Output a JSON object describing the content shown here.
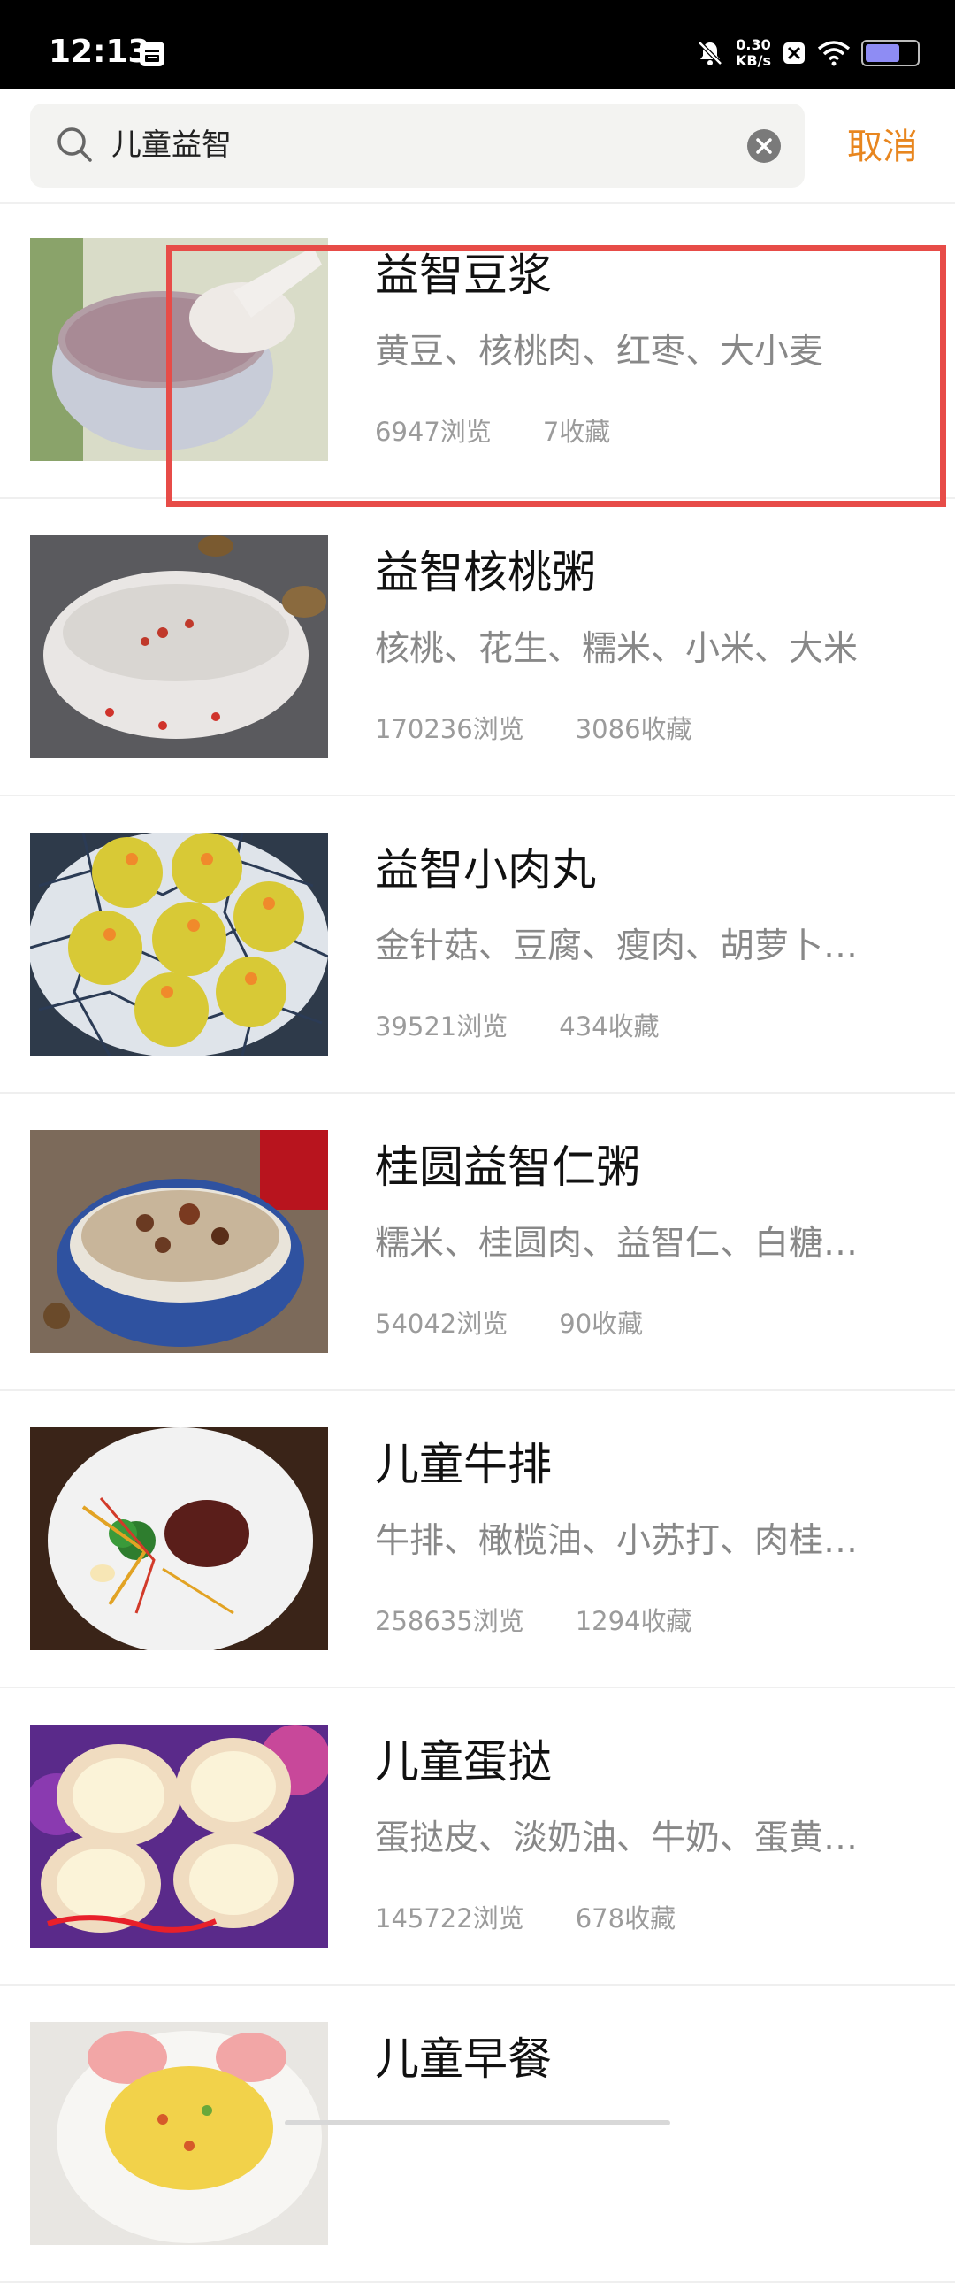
{
  "status_bar": {
    "time": "12:13",
    "net_speed_value": "0.30",
    "net_speed_unit": "KB/s",
    "battery_level": 0.7
  },
  "search": {
    "query": "儿童益智",
    "cancel_label": "取消"
  },
  "results": [
    {
      "title": "益智豆浆",
      "ingredients": "黄豆、核桃肉、红枣、大小麦",
      "views": "6947浏览",
      "favorites": "7收藏"
    },
    {
      "title": "益智核桃粥",
      "ingredients": "核桃、花生、糯米、小米、大米",
      "views": "170236浏览",
      "favorites": "3086收藏"
    },
    {
      "title": "益智小肉丸",
      "ingredients": "金针菇、豆腐、瘦肉、胡萝卜…",
      "views": "39521浏览",
      "favorites": "434收藏"
    },
    {
      "title": "桂圆益智仁粥",
      "ingredients": "糯米、桂圆肉、益智仁、白糖…",
      "views": "54042浏览",
      "favorites": "90收藏"
    },
    {
      "title": "儿童牛排",
      "ingredients": "牛排、橄榄油、小苏打、肉桂…",
      "views": "258635浏览",
      "favorites": "1294收藏"
    },
    {
      "title": "儿童蛋挞",
      "ingredients": "蛋挞皮、淡奶油、牛奶、蛋黄…",
      "views": "145722浏览",
      "favorites": "678收藏"
    },
    {
      "title": "儿童早餐",
      "ingredients": "",
      "views": "",
      "favorites": ""
    }
  ],
  "colors": {
    "accent": "#e8861f",
    "highlight": "#e74c48"
  }
}
